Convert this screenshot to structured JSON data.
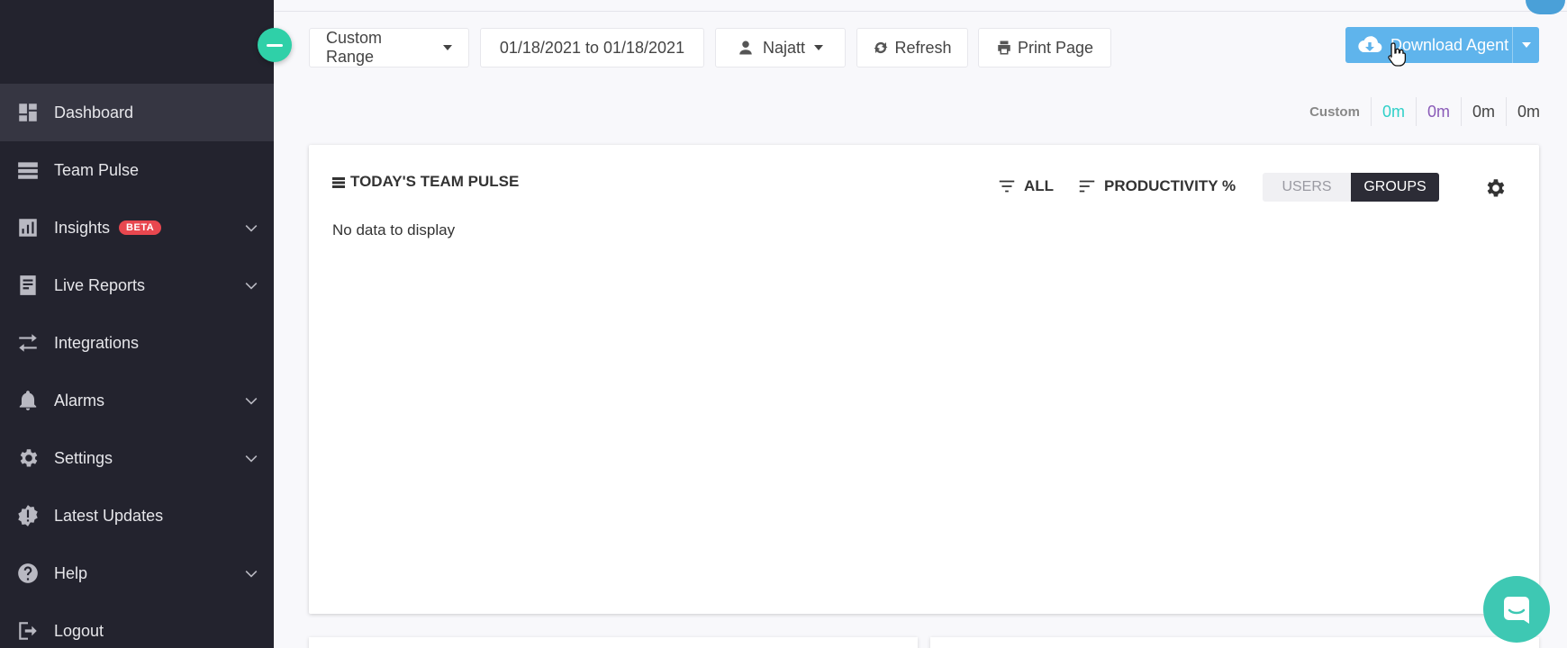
{
  "sidebar": {
    "items": [
      {
        "label": "Dashboard",
        "icon": "dashboard-icon"
      },
      {
        "label": "Team Pulse",
        "icon": "team-pulse-icon"
      },
      {
        "label": "Insights",
        "icon": "insights-icon",
        "badge": "BETA"
      },
      {
        "label": "Live Reports",
        "icon": "live-reports-icon"
      },
      {
        "label": "Integrations",
        "icon": "integrations-icon"
      },
      {
        "label": "Alarms",
        "icon": "bell-icon"
      },
      {
        "label": "Settings",
        "icon": "gear-icon"
      },
      {
        "label": "Latest Updates",
        "icon": "updates-badge-icon"
      },
      {
        "label": "Help",
        "icon": "help-icon"
      },
      {
        "label": "Logout",
        "icon": "logout-icon"
      }
    ],
    "active": "Dashboard"
  },
  "toolbar": {
    "range_label": "Custom Range",
    "date_range": "01/18/2021 to 01/18/2021",
    "user_label": "Najatt",
    "refresh_label": "Refresh",
    "print_label": "Print Page",
    "download_label": "Download Agent"
  },
  "time_summary": {
    "label": "Custom",
    "values": [
      {
        "value": "0m",
        "color": "#2fd0c8"
      },
      {
        "value": "0m",
        "color": "#8a5bb8"
      },
      {
        "value": "0m",
        "color": "#444444"
      },
      {
        "value": "0m",
        "color": "#444444"
      }
    ]
  },
  "team_pulse": {
    "title": "TODAY'S TEAM PULSE",
    "filter_all": "ALL",
    "sort_label": "PRODUCTIVITY %",
    "toggle": {
      "users": "USERS",
      "groups": "GROUPS",
      "selected": "GROUPS"
    },
    "empty_message": "No data to display"
  },
  "colors": {
    "sidebar_bg": "#23232e",
    "accent_teal": "#2fd0a8",
    "download_blue": "#5fb4ec",
    "beta_red": "#e8474f"
  }
}
